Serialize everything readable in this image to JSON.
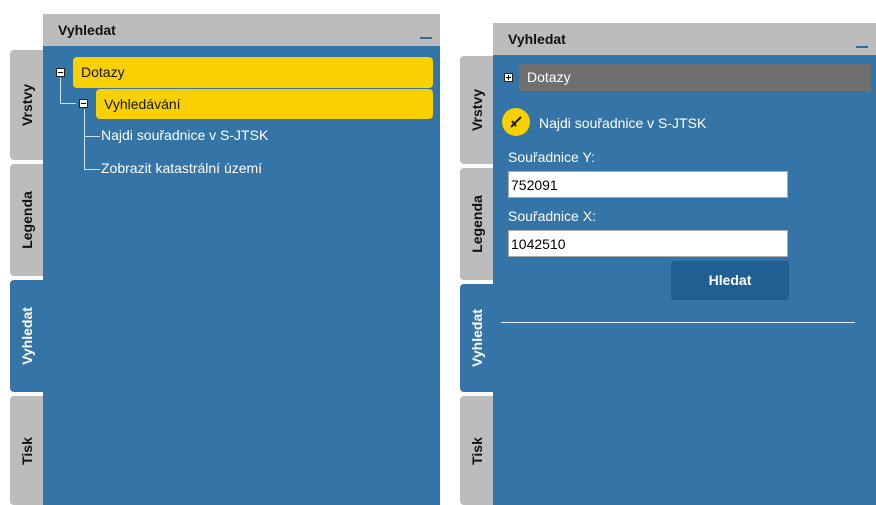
{
  "left": {
    "tabs": [
      "Vrstvy",
      "Legenda",
      "Vyhledat",
      "Tisk"
    ],
    "panel_title": "Vyhledat",
    "tree": {
      "root": "Dotazy",
      "group": "Vyhledávání",
      "items": [
        "Najdi souřadnice v S-JTSK",
        "Zobrazit katastrální území"
      ]
    }
  },
  "right": {
    "tabs": [
      "Vrstvy",
      "Legenda",
      "Vyhledat",
      "Tisk"
    ],
    "panel_title": "Vyhledat",
    "section": "Dotazy",
    "tool_title": "Najdi souřadnice v S-JTSK",
    "label_y": "Souřadnice Y:",
    "value_y": "752091",
    "label_x": "Souřadnice X:",
    "value_x": "1042510",
    "button": "Hledat"
  },
  "colors": {
    "panel_blue": "#3574a6",
    "highlight_yellow": "#f9d100",
    "tab_gray": "#bcbcbc"
  },
  "icons": [
    "minimize-icon",
    "tree-collapse-icon",
    "tree-expand-icon",
    "crosshair-icon"
  ]
}
